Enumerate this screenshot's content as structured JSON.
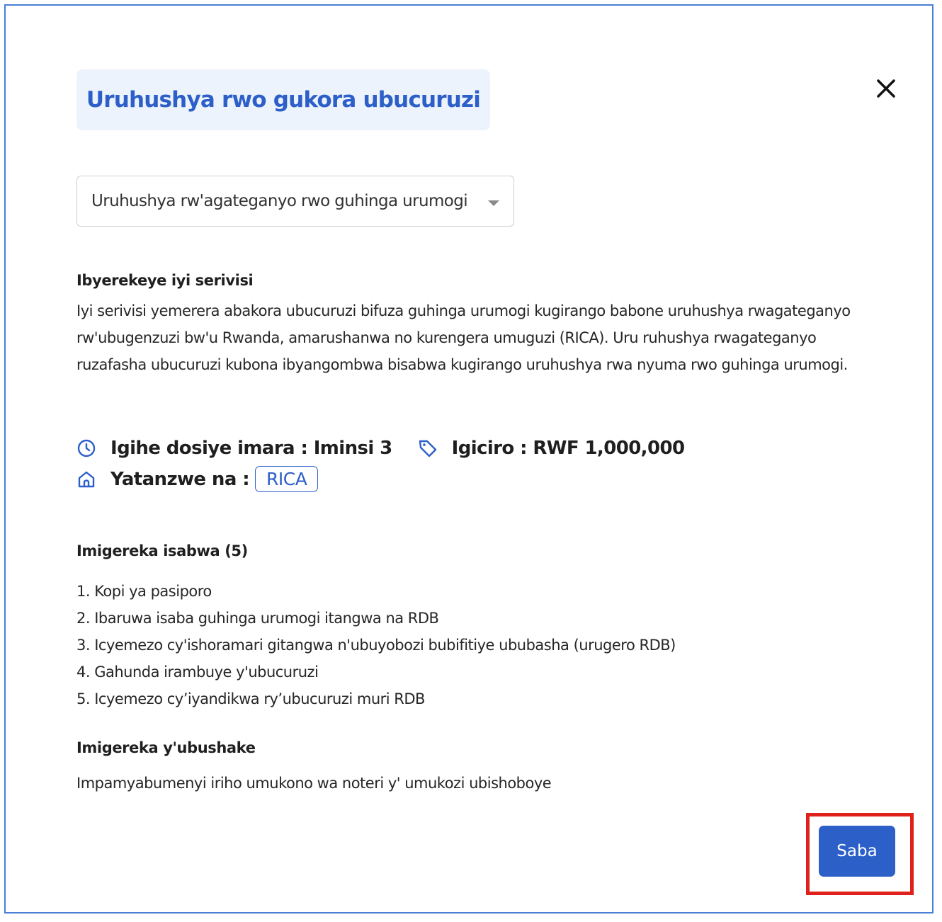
{
  "modal": {
    "title": "Uruhushya rwo gukora ubucuruzi",
    "close_icon": "close-icon"
  },
  "select": {
    "value": "Uruhushya rw'agateganyo rwo guhinga urumogi",
    "icon": "caret-down-icon"
  },
  "about": {
    "heading": "Ibyerekeye iyi serivisi",
    "text": "Iyi serivisi yemerera abakora ubucuruzi bifuza guhinga urumogi kugirango babone uruhushya rwagateganyo rw'ubugenzuzi bw'u Rwanda, amarushanwa no kurengera umuguzi (RICA). Uru ruhushya rwagateganyo ruzafasha ubucuruzi kubona ibyangombwa bisabwa kugirango uruhushya rwa nyuma rwo guhinga urumogi."
  },
  "meta": {
    "duration": "Igihe dosiye imara : Iminsi 3",
    "price": "Igiciro : RWF 1,000,000",
    "provider_label": "Yatanzwe na :",
    "provider": "RICA",
    "icons": {
      "duration": "clock-icon",
      "price": "tag-icon",
      "provider": "home-icon"
    },
    "accent_color": "#2d5fc9"
  },
  "requirements": {
    "heading": "Imigereka isabwa (5)",
    "items": [
      "1. Kopi ya pasiporo",
      "2. Ibaruwa isaba guhinga urumogi itangwa na RDB",
      "3. Icyemezo cy'ishoramari gitangwa n'ubuyobozi bubifitiye ububasha (urugero RDB)",
      "4. Gahunda irambuye y'ubucuruzi",
      "5. Icyemezo cy’iyandikwa ry’ubucuruzi muri RDB"
    ]
  },
  "optional": {
    "heading": "Imigereka y'ubushake",
    "text": "Impamyabumenyi iriho umukono wa noteri y' umukozi ubishoboye"
  },
  "actions": {
    "apply_label": "Saba",
    "highlight_color": "#e0201b"
  }
}
